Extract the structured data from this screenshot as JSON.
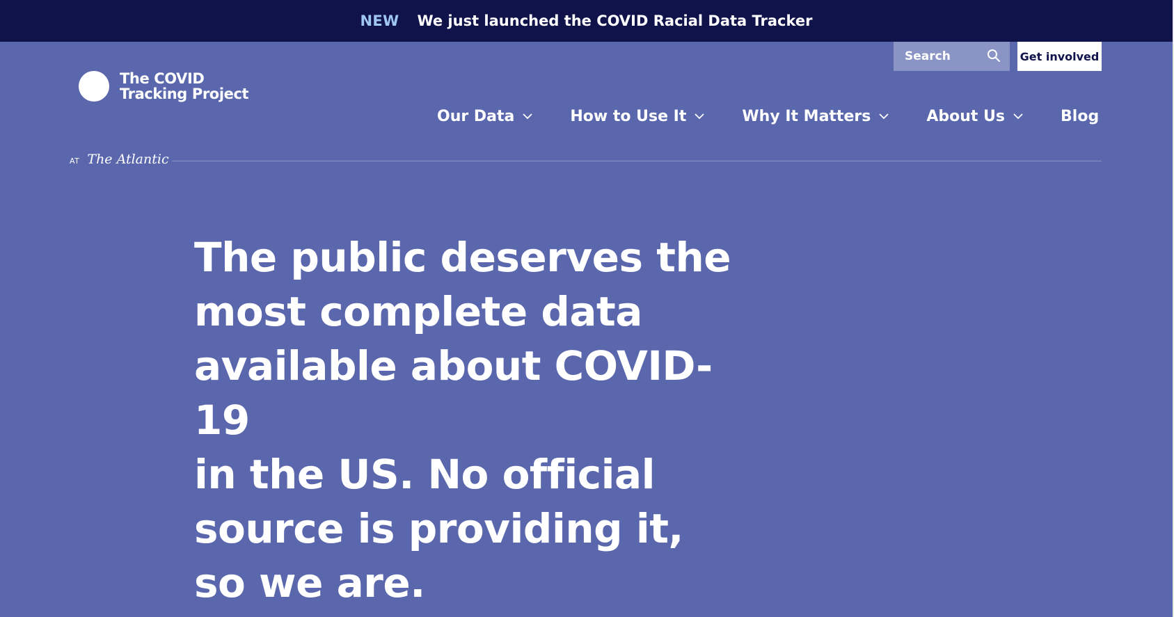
{
  "banner": {
    "tag": "NEW",
    "message": "We just launched the COVID Racial Data Tracker"
  },
  "logo": {
    "line1": "The COVID",
    "line2": "Tracking Project",
    "icon": "crescent-circle-logo-icon"
  },
  "header": {
    "search_placeholder": "Search",
    "search_icon": "search-icon",
    "get_involved_label": "Get involved"
  },
  "nav": {
    "items": [
      {
        "label": "Our Data",
        "dropdown": true
      },
      {
        "label": "How to Use It",
        "dropdown": true
      },
      {
        "label": "Why It Matters",
        "dropdown": true
      },
      {
        "label": "About Us",
        "dropdown": true
      },
      {
        "label": "Blog",
        "dropdown": false
      }
    ]
  },
  "atlantic": {
    "prefix": "AT",
    "brand": "The Atlantic"
  },
  "hero": {
    "lines": [
      "The public deserves the",
      "most complete data",
      "available about COVID-19",
      "in the US. No official",
      "source is providing it,",
      "so we are."
    ]
  },
  "colors": {
    "page_background": "#5a67ad",
    "banner_background": "#10134a",
    "banner_tag": "#9fc6f2",
    "search_background": "#8a95c6",
    "text": "#ffffff"
  }
}
